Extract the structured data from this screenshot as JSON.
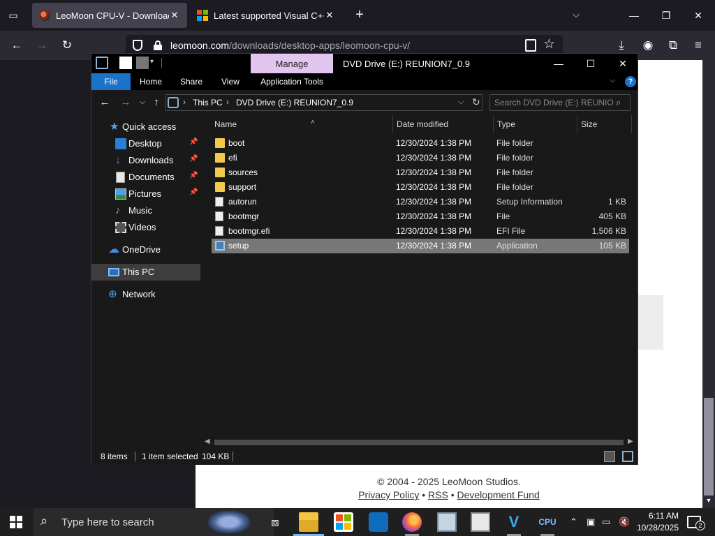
{
  "browser": {
    "tabs": [
      {
        "title": "LeoMoon CPU-V - Downloads",
        "active": true
      },
      {
        "title": "Latest supported Visual C++ Re",
        "active": false
      }
    ],
    "url_host": "leomoon.com",
    "url_path": "/downloads/desktop-apps/leomoon-cpu-v/",
    "icons": {
      "tab_list": "tab-list-icon",
      "new_tab": "plus-icon",
      "list_all_tabs": "chevron-down-icon",
      "back": "back-arrow-icon",
      "forward": "forward-arrow-icon",
      "reload": "reload-icon",
      "downloads": "download-icon",
      "account": "account-icon",
      "extensions": "puzzle-icon",
      "menu": "hamburger-menu-icon"
    }
  },
  "page": {
    "copyright": "© 2004 - 2025 LeoMoon Studios.",
    "links": [
      "Privacy Policy",
      "RSS",
      "Development Fund"
    ],
    "link_separator": "•"
  },
  "explorer": {
    "title": "DVD Drive (E:) REUNION7_0.9",
    "manage_label": "Manage",
    "ribbon_tabs": [
      "File",
      "Home",
      "Share",
      "View",
      "Application Tools"
    ],
    "help_label": "?",
    "breadcrumb": [
      "This PC",
      "DVD Drive (E:) REUNION7_0.9"
    ],
    "search_placeholder": "Search DVD Drive (E:) REUNIO...",
    "nav": {
      "quick_access": "Quick access",
      "items": [
        {
          "label": "Desktop",
          "icon": "desktop-icon",
          "pinned": true
        },
        {
          "label": "Downloads",
          "icon": "downloads-icon",
          "pinned": true
        },
        {
          "label": "Documents",
          "icon": "documents-icon",
          "pinned": true
        },
        {
          "label": "Pictures",
          "icon": "pictures-icon",
          "pinned": true
        },
        {
          "label": "Music",
          "icon": "music-icon",
          "pinned": false
        },
        {
          "label": "Videos",
          "icon": "videos-icon",
          "pinned": false
        }
      ],
      "onedrive": "OneDrive",
      "this_pc": "This PC",
      "network": "Network"
    },
    "columns": [
      "Name",
      "Date modified",
      "Type",
      "Size"
    ],
    "files": [
      {
        "name": "boot",
        "date": "12/30/2024 1:38 PM",
        "type": "File folder",
        "size": "",
        "icon": "folder-icon"
      },
      {
        "name": "efi",
        "date": "12/30/2024 1:38 PM",
        "type": "File folder",
        "size": "",
        "icon": "folder-icon"
      },
      {
        "name": "sources",
        "date": "12/30/2024 1:38 PM",
        "type": "File folder",
        "size": "",
        "icon": "folder-icon"
      },
      {
        "name": "support",
        "date": "12/30/2024 1:38 PM",
        "type": "File folder",
        "size": "",
        "icon": "folder-icon"
      },
      {
        "name": "autorun",
        "date": "12/30/2024 1:38 PM",
        "type": "Setup Information",
        "size": "1 KB",
        "icon": "settings-file-icon"
      },
      {
        "name": "bootmgr",
        "date": "12/30/2024 1:38 PM",
        "type": "File",
        "size": "405 KB",
        "icon": "file-icon"
      },
      {
        "name": "bootmgr.efi",
        "date": "12/30/2024 1:38 PM",
        "type": "EFI File",
        "size": "1,506 KB",
        "icon": "file-icon"
      },
      {
        "name": "setup",
        "date": "12/30/2024 1:38 PM",
        "type": "Application",
        "size": "105 KB",
        "icon": "setup-app-icon",
        "selected": true
      }
    ],
    "status": {
      "items": "8 items",
      "selected": "1 item selected",
      "size": "104 KB"
    }
  },
  "taskbar": {
    "search_placeholder": "Type here to search",
    "apps": [
      "task-view-icon",
      "file-explorer-icon",
      "microsoft-store-icon",
      "outlook-icon",
      "firefox-icon",
      "control-panel-icon",
      "notepad-icon",
      "vscode-icon",
      "cpu-z-icon"
    ],
    "time": "6:11 AM",
    "date": "10/28/2025",
    "notification_count": "2"
  }
}
